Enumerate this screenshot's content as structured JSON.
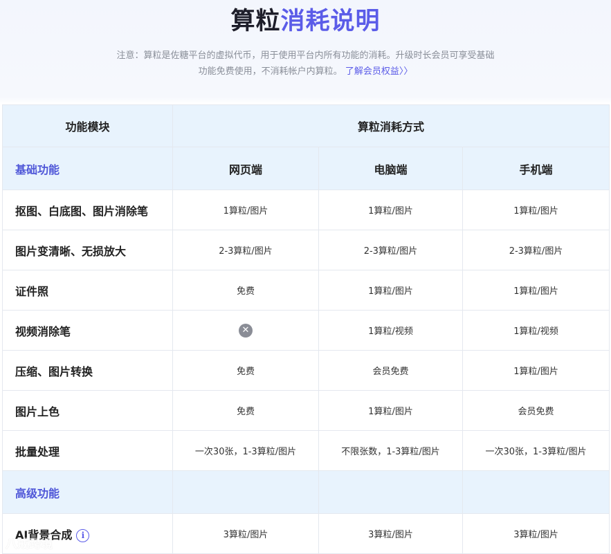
{
  "header": {
    "title_plain": "算粒",
    "title_accent": "消耗说明",
    "notice_line1": "注意：算粒是佐糖平台的虚拟代币，用于使用平台内所有功能的消耗。升级时长会员可享受基础",
    "notice_line2": "功能免费使用，不消耗帐户内算粒。",
    "notice_link": "了解会员权益〉〉"
  },
  "table": {
    "col_module": "功能模块",
    "col_cost": "算粒消耗方式",
    "platforms": [
      "网页端",
      "电脑端",
      "手机端"
    ],
    "sections": [
      {
        "label": "基础功能",
        "rows": [
          {
            "feature": "抠图、白底图、图片消除笔",
            "web": "1算粒/图片",
            "pc": "1算粒/图片",
            "mobile": "1算粒/图片"
          },
          {
            "feature": "图片变清晰、无损放大",
            "web": "2-3算粒/图片",
            "pc": "2-3算粒/图片",
            "mobile": "2-3算粒/图片"
          },
          {
            "feature": "证件照",
            "web": "免费",
            "pc": "1算粒/图片",
            "mobile": "1算粒/图片"
          },
          {
            "feature": "视频消除笔",
            "web": "",
            "web_icon": "unavailable-x-icon",
            "pc": "1算粒/视频",
            "mobile": "1算粒/视频"
          },
          {
            "feature": "压缩、图片转换",
            "web": "免费",
            "pc": "会员免费",
            "mobile": "1算粒/图片"
          },
          {
            "feature": "图片上色",
            "web": "免费",
            "pc": "1算粒/图片",
            "mobile": "会员免费"
          },
          {
            "feature": "批量处理",
            "web": "一次30张，1-3算粒/图片",
            "pc": "不限张数，1-3算粒/图片",
            "mobile": "一次30张，1-3算粒/图片"
          }
        ]
      },
      {
        "label": "高级功能",
        "rows": [
          {
            "feature": "AI背景合成",
            "feature_icon": "info-icon",
            "web": "3算粒/图片",
            "pc": "3算粒/图片",
            "mobile": "3算粒/图片"
          }
        ]
      }
    ]
  },
  "watermark": "八戒跨境",
  "colors": {
    "accent": "#5b5ce8",
    "header_bg": "#e8f3fd",
    "border": "#e4e8ef"
  }
}
